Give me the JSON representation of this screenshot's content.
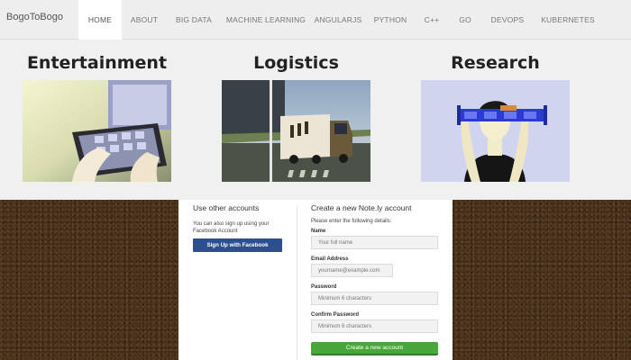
{
  "brand": "BogoToBogo",
  "nav": {
    "items": [
      {
        "label": "HOME",
        "active": true
      },
      {
        "label": "ABOUT"
      },
      {
        "label": "BIG DATA"
      },
      {
        "label": "MACHINE LEARNING"
      },
      {
        "label": "ANGULARJS"
      },
      {
        "label": "PYTHON"
      },
      {
        "label": "C++"
      },
      {
        "label": "GO"
      },
      {
        "label": "DEVOPS"
      },
      {
        "label": "KUBERNETES"
      }
    ]
  },
  "features": [
    {
      "title": "Entertainment",
      "image": "tablet-photo"
    },
    {
      "title": "Logistics",
      "image": "truck-photo"
    },
    {
      "title": "Research",
      "image": "person-panels-photo"
    }
  ],
  "signup": {
    "other": {
      "heading": "Use other accounts",
      "text": "You can also sign up using your Facebook Account",
      "facebook_button": "Sign Up with Facebook"
    },
    "create": {
      "heading": "Create a new Note.ly account",
      "subheading": "Please enter the following details:",
      "fields": [
        {
          "label": "Name",
          "placeholder": "Your full name"
        },
        {
          "label": "Email Address",
          "placeholder": "yourname@example.com"
        },
        {
          "label": "Password",
          "placeholder": "Minimum 6 characters"
        },
        {
          "label": "Confirm Password",
          "placeholder": "Minimum 6 characters"
        }
      ],
      "submit": "Create a new account"
    }
  },
  "colors": {
    "facebook": "#2d4f8f",
    "submit": "#48a73b",
    "background_wood": "#4a321d"
  }
}
